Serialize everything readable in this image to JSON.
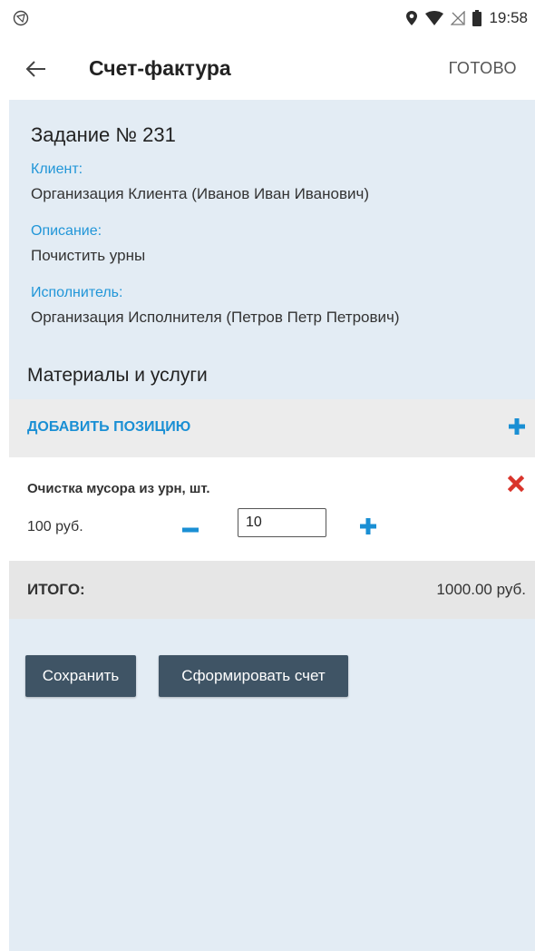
{
  "status_bar": {
    "time": "19:58",
    "icons": [
      "vpn-icon",
      "location-icon",
      "wifi-icon",
      "signal-off-icon",
      "battery-icon"
    ]
  },
  "app_bar": {
    "back_icon": "arrow-left-icon",
    "title": "Счет-фактура",
    "done_label": "ГОТОВО"
  },
  "task": {
    "title": "Задание № 231",
    "client_label": "Клиент:",
    "client_value": "Организация Клиента (Иванов Иван Иванович)",
    "description_label": "Описание:",
    "description_value": "Почистить урны",
    "executor_label": "Исполнитель:",
    "executor_value": "Организация Исполнителя (Петров Петр Петрович)"
  },
  "materials": {
    "section_title": "Материалы и услуги",
    "add_label": "ДОБАВИТЬ ПОЗИЦИЮ",
    "items": [
      {
        "name": "Очистка мусора из урн, шт.",
        "price": "100 руб.",
        "quantity": "10"
      }
    ]
  },
  "total": {
    "label": "ИТОГО:",
    "value": "1000.00 руб."
  },
  "actions": {
    "save_label": "Сохранить",
    "invoice_label": "Сформировать счет"
  },
  "colors": {
    "accent": "#1a8fd4",
    "label_blue": "#2196d8",
    "delete_red": "#d9342b",
    "button_bg": "#3f5465",
    "content_bg": "#e3ecf4"
  }
}
